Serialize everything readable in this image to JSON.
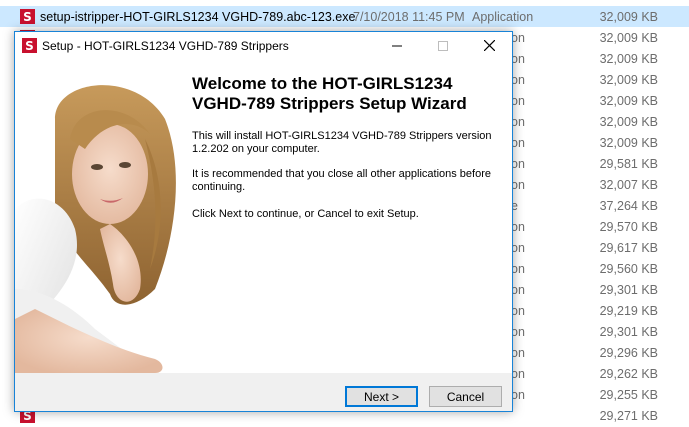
{
  "files": [
    {
      "name": "setup-istripper-HOT-GIRLS1234 VGHD-789.abc-123.exe",
      "date": "7/10/2018 11:45 PM",
      "type": "Application",
      "size": "32,009 KB",
      "selected": true
    },
    {
      "name": "",
      "date": "",
      "type": "",
      "size": "32,009 KB"
    },
    {
      "name": "",
      "date": "",
      "type": "",
      "size": "32,009 KB"
    },
    {
      "name": "",
      "date": "",
      "type": "",
      "size": "32,009 KB"
    },
    {
      "name": "",
      "date": "",
      "type": "",
      "size": "32,009 KB"
    },
    {
      "name": "",
      "date": "",
      "type": "",
      "size": "32,009 KB"
    },
    {
      "name": "",
      "date": "",
      "type": "",
      "size": "32,009 KB"
    },
    {
      "name": "",
      "date": "",
      "type": "",
      "size": "29,581 KB"
    },
    {
      "name": "",
      "date": "",
      "type": "",
      "size": "32,007 KB"
    },
    {
      "name": "",
      "date": "",
      "type": "",
      "size": "37,264 KB"
    },
    {
      "name": "",
      "date": "",
      "type": "",
      "size": "29,570 KB"
    },
    {
      "name": "",
      "date": "",
      "type": "",
      "size": "29,617 KB"
    },
    {
      "name": "",
      "date": "",
      "type": "",
      "size": "29,560 KB"
    },
    {
      "name": "",
      "date": "",
      "type": "",
      "size": "29,301 KB"
    },
    {
      "name": "",
      "date": "",
      "type": "",
      "size": "29,219 KB"
    },
    {
      "name": "",
      "date": "",
      "type": "",
      "size": "29,301 KB"
    },
    {
      "name": "",
      "date": "",
      "type": "",
      "size": "29,296 KB"
    },
    {
      "name": "",
      "date": "",
      "type": "",
      "size": "29,262 KB"
    },
    {
      "name": "",
      "date": "",
      "type": "",
      "size": "29,255 KB"
    },
    {
      "name": "",
      "date": "",
      "type": "",
      "size": "29,271 KB"
    }
  ],
  "type_fragments": [
    "",
    "on",
    "on",
    "on",
    "on",
    "on",
    "on",
    "on",
    "on",
    "e",
    "on",
    "on",
    "on",
    "on",
    "on",
    "on",
    "on",
    "on",
    "on",
    ""
  ],
  "dialog": {
    "title": "Setup - HOT-GIRLS1234 VGHD-789 Strippers",
    "icon_glyph": "S",
    "welcome_line1": "Welcome to the HOT-GIRLS1234",
    "welcome_line2": "VGHD-789 Strippers Setup Wizard",
    "para1_line1": "This will install HOT-GIRLS1234 VGHD-789 Strippers version",
    "para1_line2": "1.2.202 on your computer.",
    "para2_line1": "It is recommended that you close all other applications before",
    "para2_line2": "continuing.",
    "para3": "Click Next to continue, or Cancel to exit Setup.",
    "next_label": "Next >",
    "cancel_label": "Cancel"
  },
  "colors": {
    "accent": "#0078d7",
    "selected_row": "#cce8ff",
    "app_icon": "#c8102e"
  }
}
